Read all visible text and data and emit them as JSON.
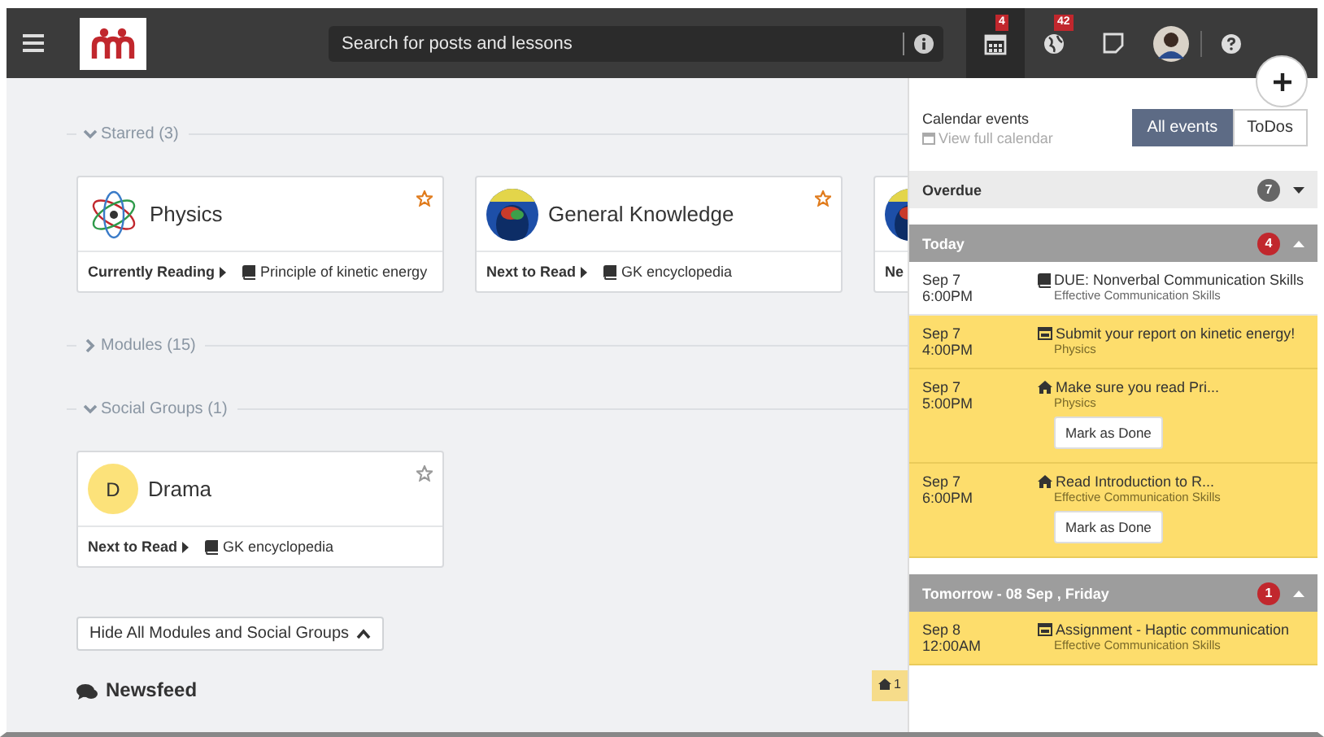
{
  "topbar": {
    "search": {
      "placeholder": "Search for posts and lessons"
    },
    "nav": [
      {
        "kind": "calendar",
        "badge": "4",
        "selected": true
      },
      {
        "kind": "globe",
        "badge": "42",
        "selected": false
      },
      {
        "kind": "note",
        "selected": false
      },
      {
        "kind": "avatar",
        "selected": false
      },
      {
        "kind": "help",
        "selected": false
      }
    ]
  },
  "sections": [
    {
      "title": "Starred (3)",
      "expanded": true,
      "cards": [
        {
          "kind": "atom",
          "title": "Physics",
          "starred": true,
          "footer_label": "Currently Reading",
          "footer_item": "Principle of kinetic energy"
        },
        {
          "kind": "picture",
          "title": "General Knowledge",
          "starred": true,
          "footer_label": "Next to Read",
          "footer_item": "GK encyclopedia"
        },
        {
          "kind": "picture",
          "footer_label": "Ne"
        }
      ]
    },
    {
      "title": "Modules (15)",
      "expanded": false
    },
    {
      "title": "Social Groups (1)",
      "expanded": true,
      "cards": [
        {
          "kind": "letter",
          "letter": "D",
          "title": "Drama",
          "starred": false,
          "footer_label": "Next to Read",
          "footer_item": "GK encyclopedia"
        }
      ]
    }
  ],
  "hide_button": "Hide All Modules and Social Groups",
  "newsfeed": {
    "title": "Newsfeed",
    "tag": "1"
  },
  "panel": {
    "title": "Calendar events",
    "link": "View full calendar",
    "filters": [
      {
        "label": "All events",
        "selected": true
      },
      {
        "label": "ToDos",
        "selected": false
      }
    ],
    "groups": [
      {
        "kind": "overdue",
        "title": "Overdue",
        "count": "7",
        "color": "#666666",
        "expanded": false
      },
      {
        "kind": "day",
        "title": "Today",
        "count": "4",
        "color": "#c1272d",
        "expanded": true,
        "events": [
          {
            "date": "Sep 7",
            "time": "6:00PM",
            "kind": "book",
            "title": "DUE: Nonverbal Communication Skills",
            "course": "Effective Communication Skills",
            "highlighted": false
          },
          {
            "date": "Sep 7",
            "time": "4:00PM",
            "kind": "calendar",
            "title": "Submit your report on kinetic energy!",
            "course": "Physics",
            "highlighted": true
          },
          {
            "date": "Sep 7",
            "time": "5:00PM",
            "kind": "home",
            "title": "Make sure you read Pri...",
            "course": "Physics",
            "button": "Mark as Done",
            "highlighted": true
          },
          {
            "date": "Sep 7",
            "time": "6:00PM",
            "kind": "home",
            "title": "Read Introduction to R...",
            "course": "Effective Communication Skills",
            "button": "Mark as Done",
            "highlighted": true
          }
        ]
      },
      {
        "kind": "day",
        "title": "Tomorrow - 08 Sep , Friday",
        "count": "1",
        "color": "#c1272d",
        "expanded": true,
        "events": [
          {
            "date": "Sep 8",
            "time": "12:00AM",
            "kind": "calendar",
            "title": "Assignment - Haptic communication",
            "course": "Effective Communication Skills",
            "highlighted": true
          }
        ]
      }
    ]
  }
}
